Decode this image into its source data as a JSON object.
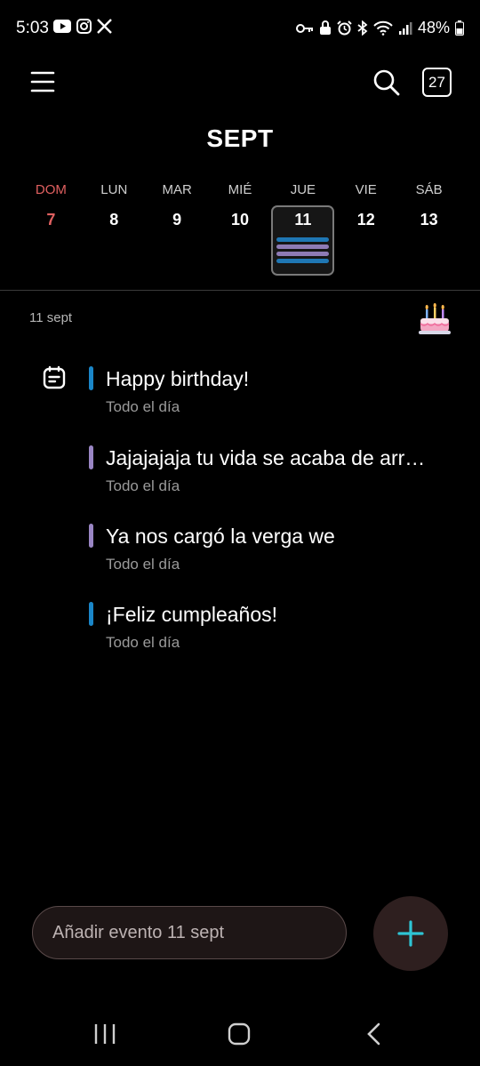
{
  "status_bar": {
    "time": "5:03",
    "left_icons": [
      "youtube-icon",
      "instagram-icon",
      "x-icon"
    ],
    "right_icons": [
      "key-icon",
      "lock-icon",
      "alarm-icon",
      "bluetooth-icon",
      "wifi-icon",
      "signal-icon"
    ],
    "battery": "48%"
  },
  "header": {
    "today_number": "27",
    "month": "SEPT"
  },
  "week": {
    "days": [
      {
        "name": "DOM",
        "num": "7"
      },
      {
        "name": "LUN",
        "num": "8"
      },
      {
        "name": "MAR",
        "num": "9"
      },
      {
        "name": "MIÉ",
        "num": "10"
      },
      {
        "name": "JUE",
        "num": "11"
      },
      {
        "name": "VIE",
        "num": "12"
      },
      {
        "name": "SÁB",
        "num": "13"
      }
    ],
    "selected_bars": [
      "#1f77b4",
      "#8e7bb5",
      "#8e7bb5",
      "#1f77b4"
    ]
  },
  "agenda": {
    "date_label": "11 sept",
    "events": [
      {
        "title": "Happy birthday!",
        "sub": "Todo el día",
        "color": "#1a86c8"
      },
      {
        "title": "Jajajajaja tu vida se acaba de arr…",
        "sub": "Todo el día",
        "color": "#9a86c4"
      },
      {
        "title": "Ya nos cargó la verga we",
        "sub": "Todo el día",
        "color": "#9a86c4"
      },
      {
        "title": "¡Feliz cumpleaños!",
        "sub": "Todo el día",
        "color": "#1a86c8"
      }
    ]
  },
  "bottom": {
    "add_placeholder": "Añadir evento 11 sept",
    "fab_color": "#2ec4d4"
  }
}
